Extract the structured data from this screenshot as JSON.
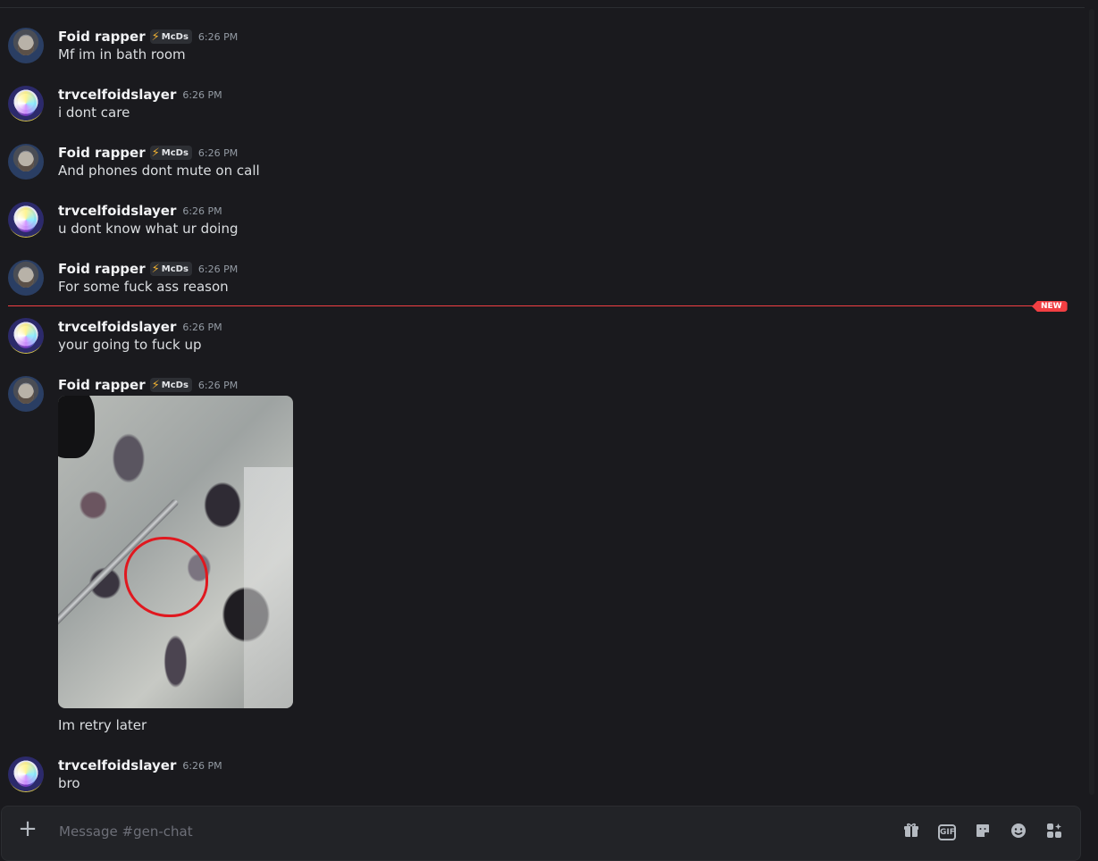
{
  "messages": [
    {
      "user": "Foid rapper",
      "tag": "McDs",
      "time": "6:26 PM",
      "text": "Mf im in bath room"
    },
    {
      "user": "trvcelfoidslayer",
      "time": "6:26 PM",
      "text": "i dont care"
    },
    {
      "user": "Foid rapper",
      "tag": "McDs",
      "time": "6:26 PM",
      "text": "And phones dont mute on call"
    },
    {
      "user": "trvcelfoidslayer",
      "time": "6:26 PM",
      "text": "u dont know what ur doing"
    },
    {
      "user": "Foid rapper",
      "tag": "McDs",
      "time": "6:26 PM",
      "text": "For some fuck ass reason"
    },
    {
      "user": "trvcelfoidslayer",
      "time": "6:26 PM",
      "text": "your going to fuck up"
    },
    {
      "user": "Foid rapper",
      "tag": "McDs",
      "time": "6:26 PM",
      "text": "Im retry later"
    },
    {
      "user": "trvcelfoidslayer",
      "time": "6:26 PM",
      "text": "bro"
    }
  ],
  "new_divider": {
    "label": "NEW"
  },
  "composer": {
    "placeholder": "Message #gen-chat"
  },
  "icons": {
    "add": "plus-icon",
    "gift": "gift-icon",
    "gif": "GIF",
    "sticker": "sticker-icon",
    "emoji": "emoji-icon",
    "apps": "apps-icon"
  },
  "colors": {
    "accent_new": "#f23f43",
    "tag_bolt": "#f0b132",
    "background": "#1a1a1e"
  }
}
